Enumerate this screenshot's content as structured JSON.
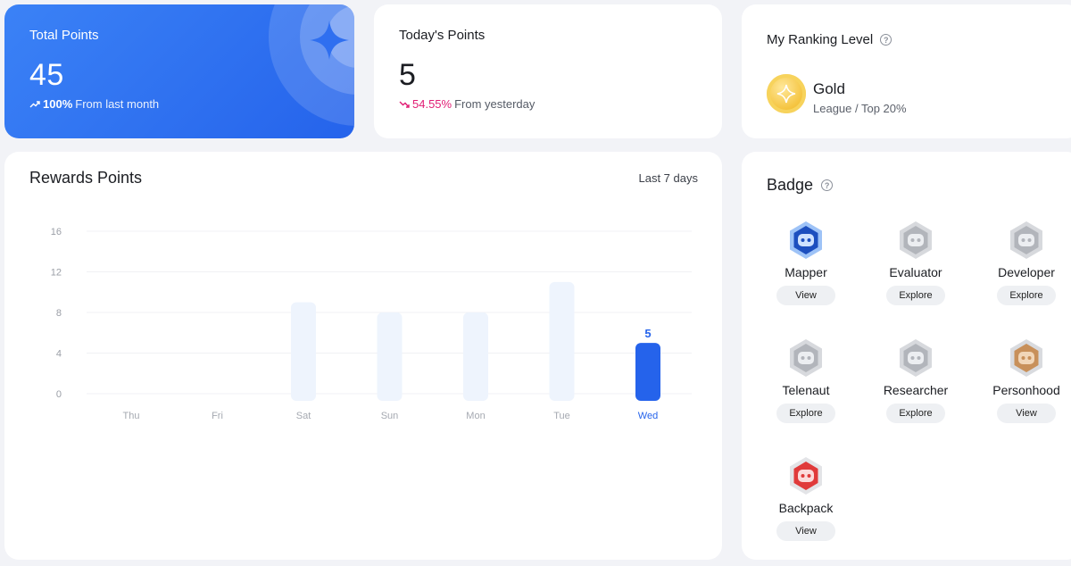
{
  "total_points": {
    "title": "Total Points",
    "value": "45",
    "change_pct": "100%",
    "change_text": "From last month",
    "accent": "#2f6ff0"
  },
  "today_points": {
    "title": "Today's Points",
    "value": "5",
    "change_pct": "54.55%",
    "change_text": "From yesterday",
    "negative_color": "#e11d74"
  },
  "ranking": {
    "title": "My Ranking Level",
    "level": "Gold",
    "subtitle": "League / Top 20%"
  },
  "rewards": {
    "title": "Rewards Points",
    "range_label": "Last 7 days"
  },
  "chart_data": {
    "type": "bar",
    "categories": [
      "Thu",
      "Fri",
      "Sat",
      "Sun",
      "Mon",
      "Tue",
      "Wed"
    ],
    "values": [
      0,
      0,
      9,
      8,
      8,
      11,
      5
    ],
    "y_ticks": [
      "16",
      "12",
      "8",
      "4",
      "0"
    ],
    "ylim": [
      0,
      16
    ],
    "highlight_index": 6,
    "highlight_label": "5",
    "bar_color": "#eef4fd",
    "highlight_color": "#2563eb",
    "grid": true
  },
  "badges": {
    "title": "Badge",
    "items": [
      {
        "name": "Mapper",
        "action": "View",
        "style": "blue"
      },
      {
        "name": "Evaluator",
        "action": "Explore",
        "style": "gray"
      },
      {
        "name": "Developer",
        "action": "Explore",
        "style": "gray"
      },
      {
        "name": "Telenaut",
        "action": "Explore",
        "style": "gray"
      },
      {
        "name": "Researcher",
        "action": "Explore",
        "style": "gray"
      },
      {
        "name": "Personhood",
        "action": "View",
        "style": "bronze"
      },
      {
        "name": "Backpack",
        "action": "View",
        "style": "red"
      }
    ]
  },
  "icons": {
    "trend_up": "trend-up-icon",
    "trend_down": "trend-down-icon",
    "help": "help-circle-icon",
    "sparkle": "sparkle-icon",
    "medal": "gold-medal-icon"
  }
}
